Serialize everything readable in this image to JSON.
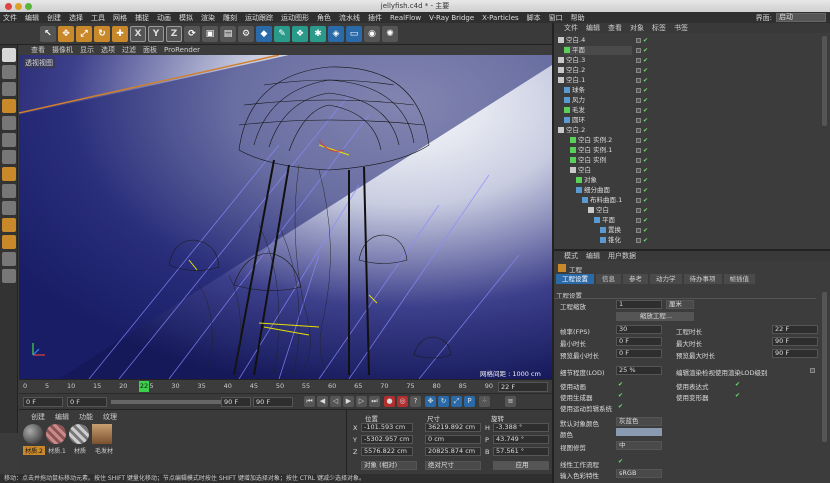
{
  "window": {
    "title": "jellyfish.c4d * - 主要"
  },
  "menubar": {
    "items": [
      "文件",
      "编辑",
      "创建",
      "选择",
      "工具",
      "网格",
      "捕捉",
      "动画",
      "模拟",
      "渲染",
      "雕刻",
      "运动跟踪",
      "运动图形",
      "角色",
      "流水线",
      "插件",
      "RealFlow",
      "V-Ray Bridge",
      "X-Particles",
      "脚本",
      "窗口",
      "帮助"
    ],
    "layout_label": "界面:",
    "layout_value": "启动"
  },
  "viewport": {
    "menu": [
      "查看",
      "摄像机",
      "显示",
      "选项",
      "过滤",
      "面板",
      "ProRender"
    ],
    "label": "透视视图",
    "grid_spacing": "网格间距 : 1000 cm"
  },
  "timeline": {
    "ticks": [
      "0",
      "5",
      "10",
      "15",
      "20",
      "25",
      "30",
      "35",
      "40",
      "45",
      "50",
      "55",
      "60",
      "65",
      "70",
      "75",
      "80",
      "85",
      "90"
    ],
    "current_frame": "22",
    "frame_display": "22 F"
  },
  "transport": {
    "start": "0 F",
    "min": "0 F",
    "max": "90 F",
    "end": "90 F"
  },
  "materials": {
    "menu": [
      "创建",
      "编辑",
      "功能",
      "纹理"
    ],
    "items": [
      "材质.2",
      "材质.1",
      "材质",
      "毛发材"
    ]
  },
  "coords": {
    "headers": [
      "位置",
      "尺寸",
      "旋转"
    ],
    "rows": [
      {
        "axis": "X",
        "pos": "-101.593 cm",
        "size": "36219.892 cm",
        "rot_label": "H",
        "rot": "-3.388 °"
      },
      {
        "axis": "Y",
        "pos": "-5302.957 cm",
        "size": "0 cm",
        "rot_label": "P",
        "rot": "43.749 °"
      },
      {
        "axis": "Z",
        "pos": "5576.822 cm",
        "size": "20825.874 cm",
        "rot_label": "B",
        "rot": "57.561 °"
      }
    ],
    "mode1": "对象 (相对)",
    "mode2": "绝对尺寸",
    "apply": "应用"
  },
  "status": "移动：点击并拖动鼠标移动元素。按住 SHIFT 键量化移动；节点编辑模式时按住 SHIFT 键增加选择对象；按住 CTRL 键减少选择对象。",
  "objects": {
    "menu": [
      "文件",
      "编辑",
      "查看",
      "对象",
      "标签",
      "书签"
    ],
    "rows": [
      {
        "name": "空白.4",
        "indent": 0,
        "sel": false,
        "icon": "#c8c8c8"
      },
      {
        "name": "平面",
        "indent": 1,
        "sel": true,
        "icon": "#5ad05a"
      },
      {
        "name": "空白.3",
        "indent": 0,
        "sel": false,
        "icon": "#c8c8c8"
      },
      {
        "name": "空白.2",
        "indent": 0,
        "sel": false,
        "icon": "#c8c8c8"
      },
      {
        "name": "空白.1",
        "indent": 0,
        "sel": false,
        "icon": "#c8c8c8"
      },
      {
        "name": "球条",
        "indent": 1,
        "sel": false,
        "icon": "#5a9ad0"
      },
      {
        "name": "风力",
        "indent": 1,
        "sel": false,
        "icon": "#5a9ad0"
      },
      {
        "name": "毛发",
        "indent": 1,
        "sel": false,
        "icon": "#5ad05a"
      },
      {
        "name": "圆环",
        "indent": 1,
        "sel": false,
        "icon": "#5a9ad0"
      },
      {
        "name": "空白.2",
        "indent": 0,
        "sel": false,
        "icon": "#c8c8c8"
      },
      {
        "name": "空白 实例.2",
        "indent": 2,
        "sel": false,
        "icon": "#5ad05a"
      },
      {
        "name": "空白 实例.1",
        "indent": 2,
        "sel": false,
        "icon": "#5ad05a"
      },
      {
        "name": "空白 实例",
        "indent": 2,
        "sel": false,
        "icon": "#5ad05a"
      },
      {
        "name": "空白",
        "indent": 2,
        "sel": false,
        "icon": "#c8c8c8"
      },
      {
        "name": "对象",
        "indent": 3,
        "sel": false,
        "icon": "#5ad05a"
      },
      {
        "name": "细分曲面",
        "indent": 3,
        "sel": false,
        "icon": "#5a9ad0"
      },
      {
        "name": "布料曲面.1",
        "indent": 4,
        "sel": false,
        "icon": "#5a9ad0"
      },
      {
        "name": "空白",
        "indent": 5,
        "sel": false,
        "icon": "#c8c8c8"
      },
      {
        "name": "平面",
        "indent": 6,
        "sel": false,
        "icon": "#5a9ad0"
      },
      {
        "name": "置换",
        "indent": 7,
        "sel": false,
        "icon": "#5a9ad0"
      },
      {
        "name": "锥化",
        "indent": 7,
        "sel": false,
        "icon": "#5a9ad0"
      }
    ]
  },
  "attributes": {
    "menu": [
      "模式",
      "编辑",
      "用户数据"
    ],
    "title": "工程",
    "tabs": [
      "工程设置",
      "信息",
      "参考",
      "动力学",
      "待办事项",
      "帧插值"
    ],
    "section": "工程设置",
    "scale_label": "工程缩放",
    "scale_value": "1",
    "scale_unit": "厘米",
    "scale_button": "缩放工程...",
    "left": [
      {
        "label": "帧率(FPS)",
        "value": "30"
      },
      {
        "label": "最小时长",
        "value": "0 F"
      },
      {
        "label": "预览最小时长",
        "value": "0 F"
      }
    ],
    "right": [
      {
        "label": "工程时长",
        "value": "22 F"
      },
      {
        "label": "最大时长",
        "value": "90 F"
      },
      {
        "label": "预览最大时长",
        "value": "90 F"
      }
    ],
    "lod_label": "细节程度(LOD)",
    "lod_value": "25 %",
    "lod_render": "编辑渲染检视使用渲染LOD级别",
    "checks_left": [
      "使用动画",
      "使用生成器",
      "使用运动剪辑系统"
    ],
    "checks_right": [
      "使用表达式",
      "使用变形器"
    ],
    "default_color_label": "默认对象颜色",
    "default_color_value": "灰蓝色",
    "color_label": "颜色",
    "view_clip_label": "视图修剪",
    "view_clip_value": "中",
    "linear_label": "线性工作流程",
    "input_color_label": "输入色彩特性",
    "input_color_value": "sRGB"
  }
}
